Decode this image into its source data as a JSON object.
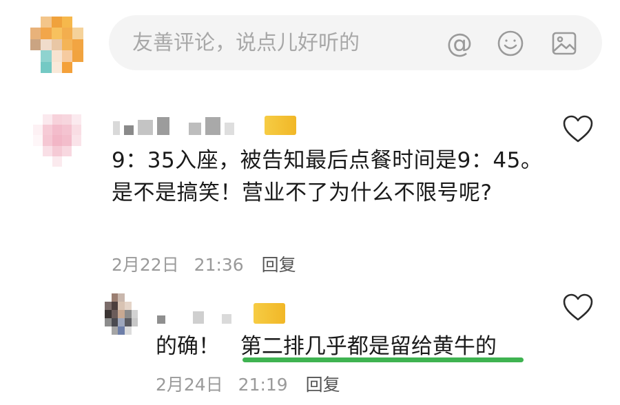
{
  "composer": {
    "placeholder": "友善评论，说点儿好听的",
    "icons": [
      "at-icon",
      "smile-icon",
      "image-icon"
    ]
  },
  "comments": [
    {
      "text": "9：35入座，被告知最后点餐时间是9：45。是不是搞笑！营业不了为什么不限号呢?",
      "date": "2月22日",
      "time": "21:36",
      "reply_label": "回复"
    },
    {
      "text_prefix": "的确！",
      "text_highlight": "第二排几乎都是留给黄牛的",
      "date": "2月24日",
      "time": "21:19",
      "reply_label": "回复"
    }
  ],
  "colors": {
    "composer_bg": "#f4f4f4",
    "meta_text": "#9a9a9a",
    "highlight_underline": "#3fb351"
  }
}
